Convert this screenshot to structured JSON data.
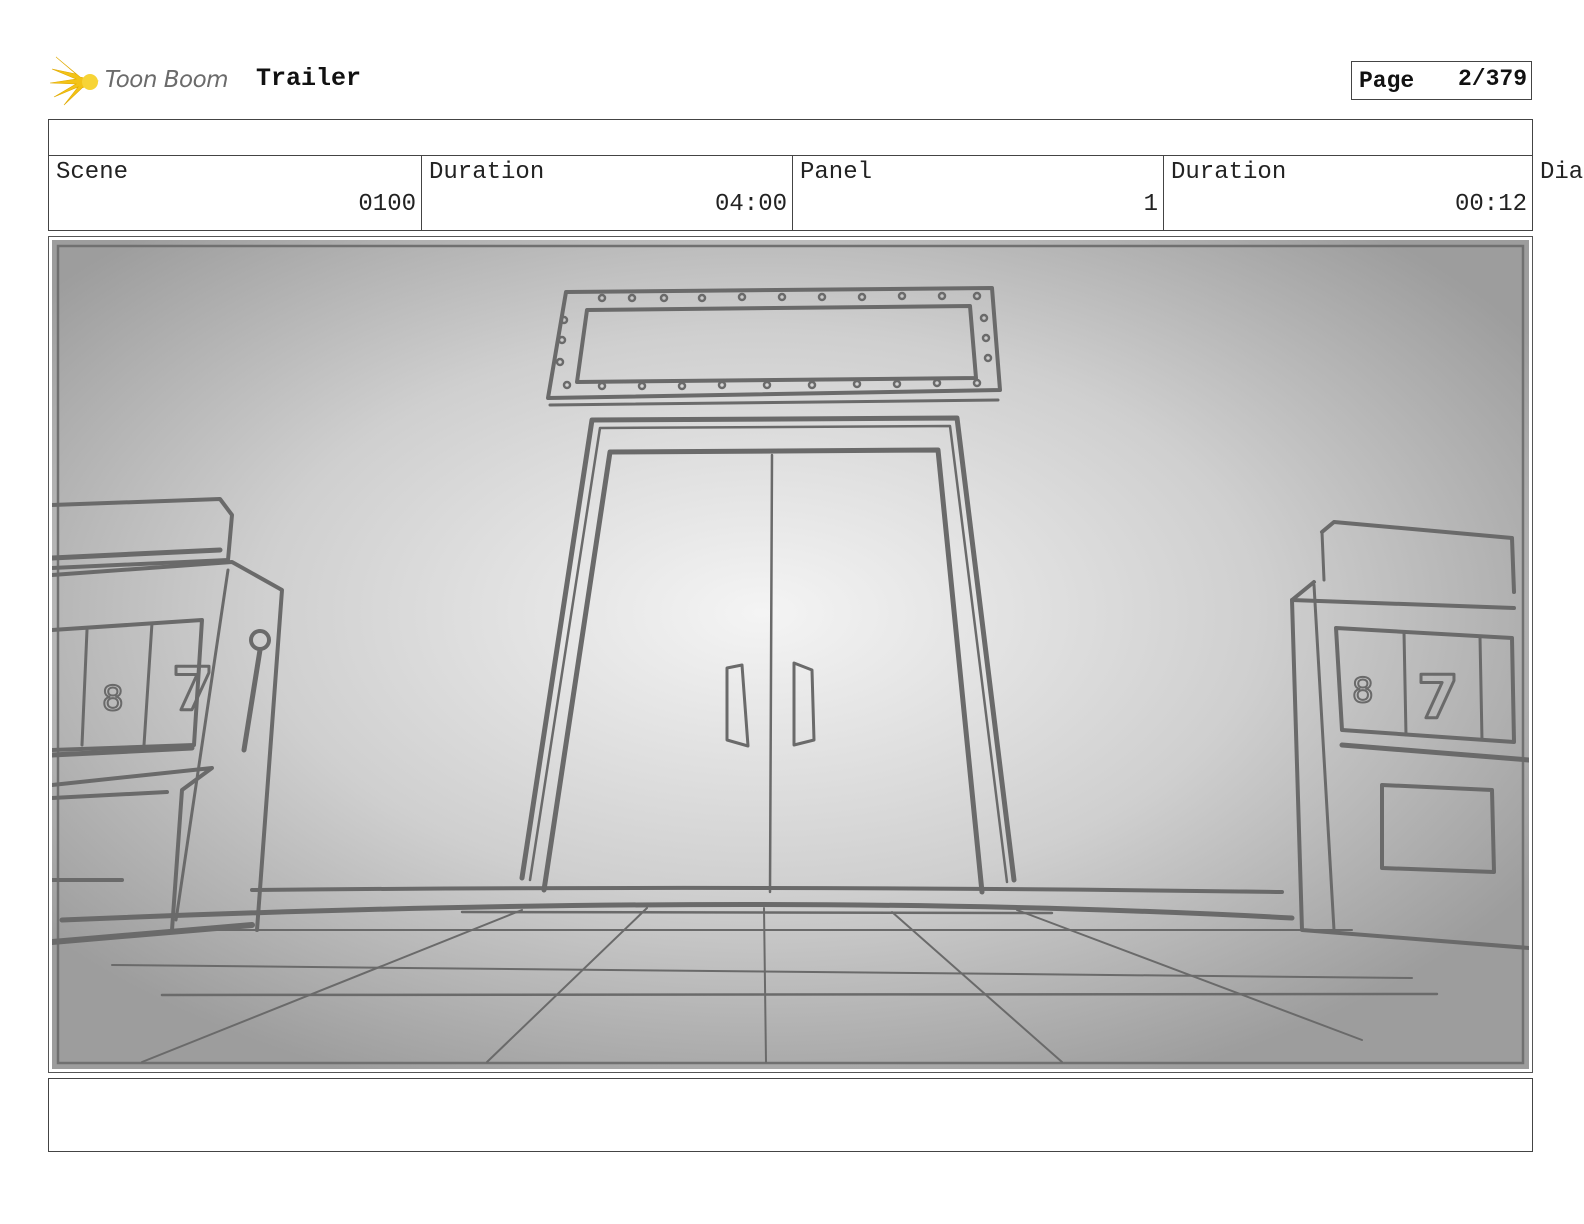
{
  "header": {
    "brand": "Toon Boom",
    "title": "Trailer",
    "page_label": "Page",
    "page_value": "2/379"
  },
  "info": {
    "scene_label": "Scene",
    "scene_value": "0100",
    "scene_duration_label": "Duration",
    "scene_duration_value": "04:00",
    "panel_label": "Panel",
    "panel_value": "1",
    "panel_duration_label": "Duration",
    "panel_duration_value": "00:12",
    "dialog_label_partial": "Dia"
  },
  "panel": {
    "icons": [
      "toon-boom-logo-icon"
    ],
    "slot_symbols_left": [
      "8",
      "7"
    ],
    "slot_symbols_right": [
      "8",
      "7"
    ]
  },
  "notes": {
    "text": ""
  }
}
